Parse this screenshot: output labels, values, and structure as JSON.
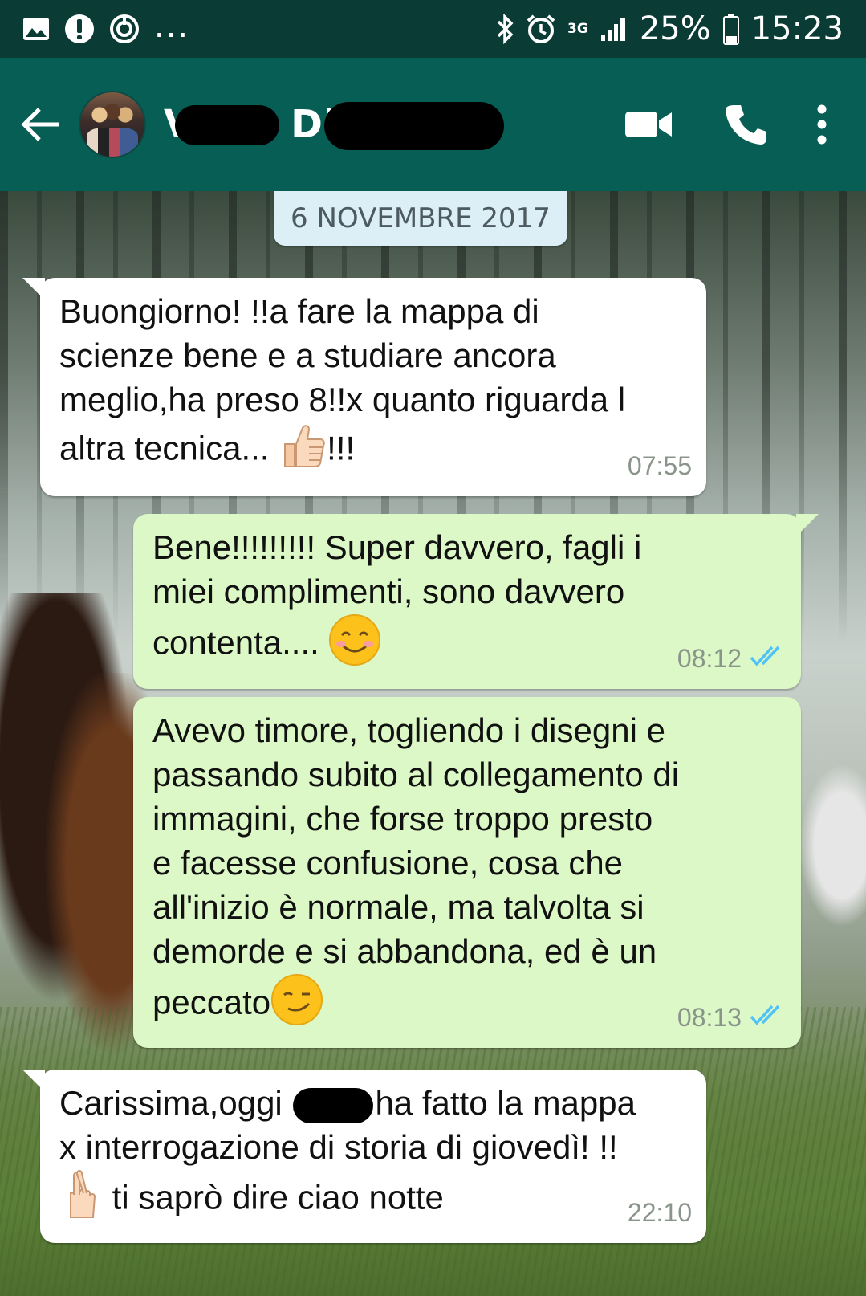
{
  "status_bar": {
    "network": "3G",
    "battery": "25%",
    "time": "15:23",
    "dots": "...",
    "icons": [
      "gallery-icon",
      "alert-icon",
      "sync-icon",
      "bluetooth-icon",
      "alarm-icon",
      "signal-icon",
      "battery-icon"
    ]
  },
  "toolbar": {
    "title_visible": "Di",
    "title_prefix_visible": "V",
    "icons": [
      "back-arrow-icon",
      "video-call-icon",
      "phone-icon",
      "more-vert-icon"
    ]
  },
  "chat": {
    "date_label": "6 NOVEMBRE 2017",
    "messages": [
      {
        "direction": "in",
        "text": "Buongiorno! !!a fare la mappa di\nscienze bene e a studiare ancora\nmeglio,ha preso 8!!x quanto riguarda l\naltra tecnica... ",
        "emoji": "thumbs-up",
        "text_after": "!!!",
        "time": "07:55"
      },
      {
        "direction": "out",
        "text": "Bene!!!!!!!!! Super davvero, fagli i\nmiei complimenti, sono davvero\ncontenta.... ",
        "emoji": "smiling-face",
        "time": "08:12",
        "status": "read"
      },
      {
        "direction": "out",
        "text": "Avevo timore, togliendo i disegni e\npassando subito al collegamento di\nimmagini, che forse troppo presto\ne facesse confusione, cosa che\nall'inizio è normale, ma talvolta si\ndemorde e si abbandona, ed è un\npeccato",
        "emoji": "winking-face",
        "time": "08:13",
        "status": "read"
      },
      {
        "direction": "in",
        "text_before": "Carissima,oggi ",
        "text": "ha fatto la mappa\nx interrogazione di storia di giovedì! !!\n",
        "emoji": "crossed-fingers",
        "text_after": " ti saprò dire ciao notte",
        "time": "22:10"
      }
    ]
  },
  "colors": {
    "status_bar": "#0a3b34",
    "toolbar": "#075e54",
    "bubble_in": "#ffffff",
    "bubble_out": "#dcf8c6",
    "read_ticks": "#4fc3f7",
    "date_chip": "#dceff7"
  }
}
